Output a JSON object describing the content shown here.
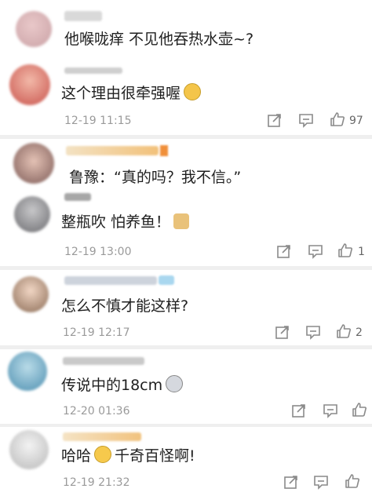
{
  "comments": [
    {
      "text": "他喉咙痒 不见他吞热水壶~?"
    },
    {
      "text": "这个理由很牵强喔",
      "time": "12-19 11:15",
      "likes": "97"
    },
    {
      "text": "鲁豫：“真的吗？我不信。”"
    },
    {
      "text": "整瓶吹 怕养鱼！",
      "time": "12-19 13:00",
      "likes": "1"
    },
    {
      "text": "怎么不慎才能这样?",
      "time": "12-19 12:17",
      "likes": "2"
    },
    {
      "text": "传说中的18cm",
      "time": "12-20 01:36"
    },
    {
      "text_a": "哈哈",
      "text_b": "千奇百怪啊!",
      "time": "12-19 21:32"
    }
  ],
  "icons": {
    "share": "share-icon",
    "comment": "comment-icon",
    "like": "thumbs-up-icon"
  },
  "colors": {
    "background": "#ffffff",
    "separator": "#efefef",
    "timestamp": "#9a9a9a",
    "icon": "#8a8a8a"
  }
}
